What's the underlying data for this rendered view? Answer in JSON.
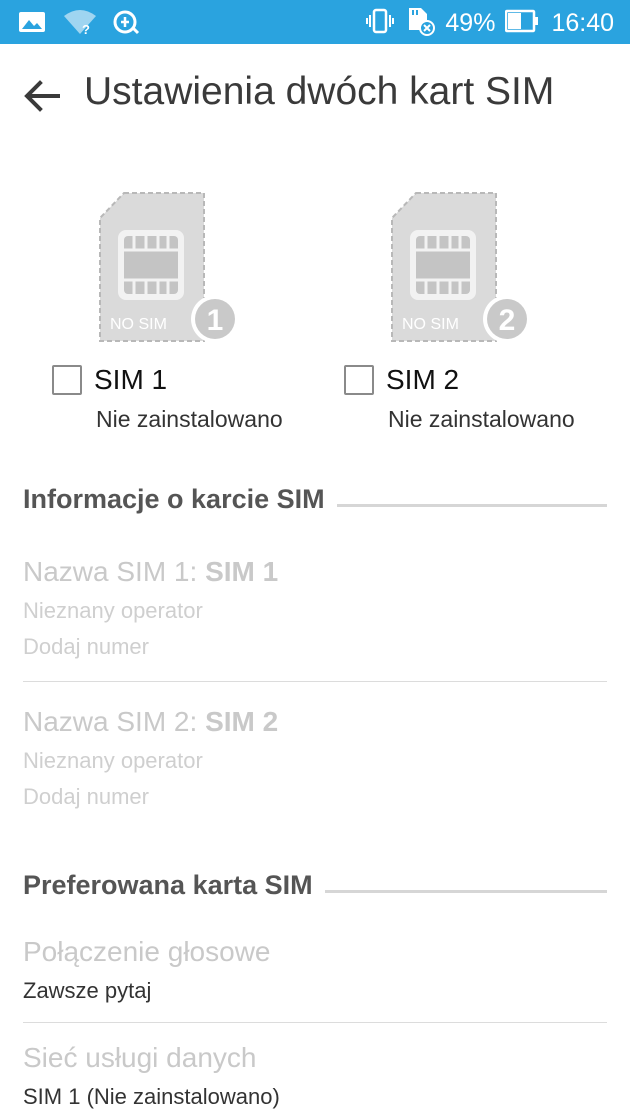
{
  "status_bar": {
    "battery_percent": "49%",
    "time": "16:40",
    "icons": [
      "gallery-icon",
      "wifi-unknown-icon",
      "data-saver-icon",
      "vibrate-icon",
      "sd-card-error-icon",
      "battery-icon"
    ]
  },
  "header": {
    "title": "Ustawienia dwóch kart SIM"
  },
  "sims": [
    {
      "card_text": "NO SIM",
      "badge": "1",
      "label": "SIM 1",
      "status": "Nie zainstalowano",
      "checked": false
    },
    {
      "card_text": "NO SIM",
      "badge": "2",
      "label": "SIM 2",
      "status": "Nie zainstalowano",
      "checked": false
    }
  ],
  "info_section": {
    "title": "Informacje o karcie SIM",
    "items": [
      {
        "name_prefix": "Nazwa SIM 1: ",
        "name_value": "SIM 1",
        "operator": "Nieznany operator",
        "number": "Dodaj numer"
      },
      {
        "name_prefix": "Nazwa SIM 2: ",
        "name_value": "SIM 2",
        "operator": "Nieznany operator",
        "number": "Dodaj numer"
      }
    ]
  },
  "preferred_section": {
    "title": "Preferowana karta SIM",
    "items": [
      {
        "title": "Połączenie głosowe",
        "value": "Zawsze pytaj"
      },
      {
        "title": "Sieć usługi danych",
        "value": "SIM 1 (Nie zainstalowano)"
      }
    ]
  },
  "colors": {
    "status_bar": "#2aa3df",
    "sim_card": "#d9d9d9",
    "sim_chip": "#bcbcbc",
    "badge": "#c9c9c9",
    "disabled_text": "#c9c9c9"
  }
}
